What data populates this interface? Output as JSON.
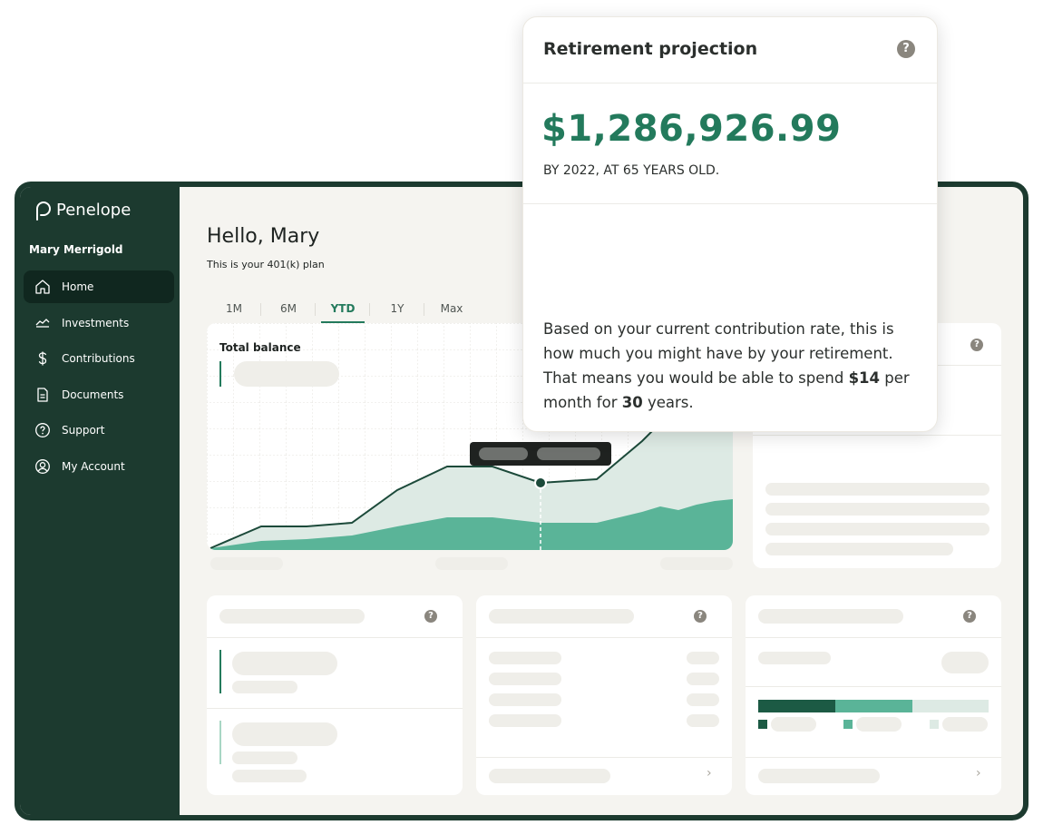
{
  "app": {
    "brand": "Penelope",
    "user_name": "Mary Merrigold",
    "colors": {
      "sidebar": "#1c3a2f",
      "accent": "#237a5c",
      "chart_light": "#ddeae4",
      "chart_mid": "#5ab498"
    }
  },
  "sidebar": {
    "items": [
      {
        "label": "Home",
        "icon": "home-icon",
        "active": true
      },
      {
        "label": "Investments",
        "icon": "investments-icon",
        "active": false
      },
      {
        "label": "Contributions",
        "icon": "dollar-icon",
        "active": false
      },
      {
        "label": "Documents",
        "icon": "document-icon",
        "active": false
      },
      {
        "label": "Support",
        "icon": "help-circle-icon",
        "active": false
      },
      {
        "label": "My Account",
        "icon": "account-icon",
        "active": false
      }
    ]
  },
  "main": {
    "greeting": "Hello, Mary",
    "subgreeting": "This is your 401(k) plan",
    "tabs": [
      {
        "label": "1M",
        "active": false
      },
      {
        "label": "6M",
        "active": false
      },
      {
        "label": "YTD",
        "active": true
      },
      {
        "label": "1Y",
        "active": false
      },
      {
        "label": "Max",
        "active": false
      }
    ],
    "chart_title": "Total balance"
  },
  "popup": {
    "title": "Retirement projection",
    "help": "?",
    "amount": "$1,286,926.99",
    "subtitle": "BY 2022, AT 65 YEARS OLD.",
    "body_pre": "Based on your current contribution rate, this is how much you might have by your retirement. That means you would be able to spend ",
    "monthly_amount": "$14",
    "body_mid": " per month for ",
    "years": "30",
    "body_post": " years."
  },
  "cards": {
    "help": "?",
    "chevron": "›"
  }
}
